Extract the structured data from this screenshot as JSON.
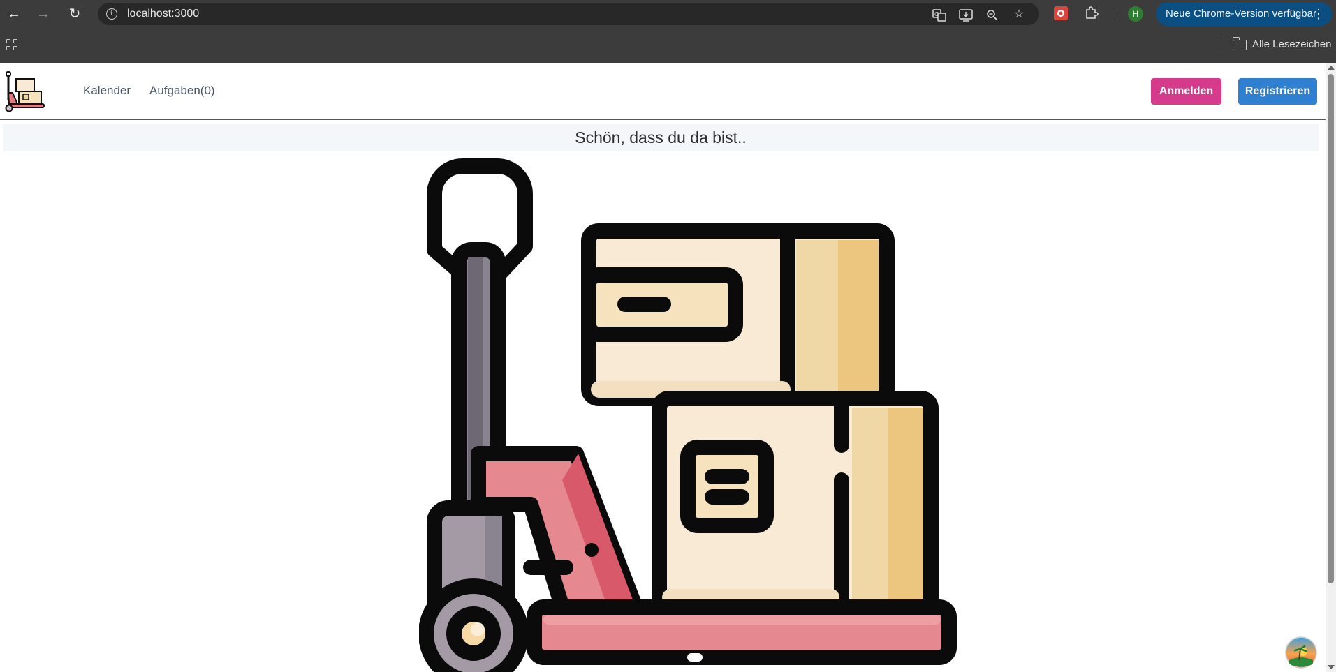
{
  "browser": {
    "url": "localhost:3000",
    "profile_initial": "H",
    "update_label": "Neue Chrome-Version verfügbar",
    "bookmarks_label": "Alle Lesezeichen"
  },
  "navbar": {
    "links": [
      {
        "label": "Kalender"
      },
      {
        "label": "Aufgaben(0)"
      }
    ],
    "login_label": "Anmelden",
    "register_label": "Registrieren"
  },
  "main": {
    "welcome": "Schön, dass du da bist.."
  },
  "colors": {
    "login_button": "#d63a8a",
    "register_button": "#2f80d0",
    "update_pill": "#0b4f82"
  }
}
